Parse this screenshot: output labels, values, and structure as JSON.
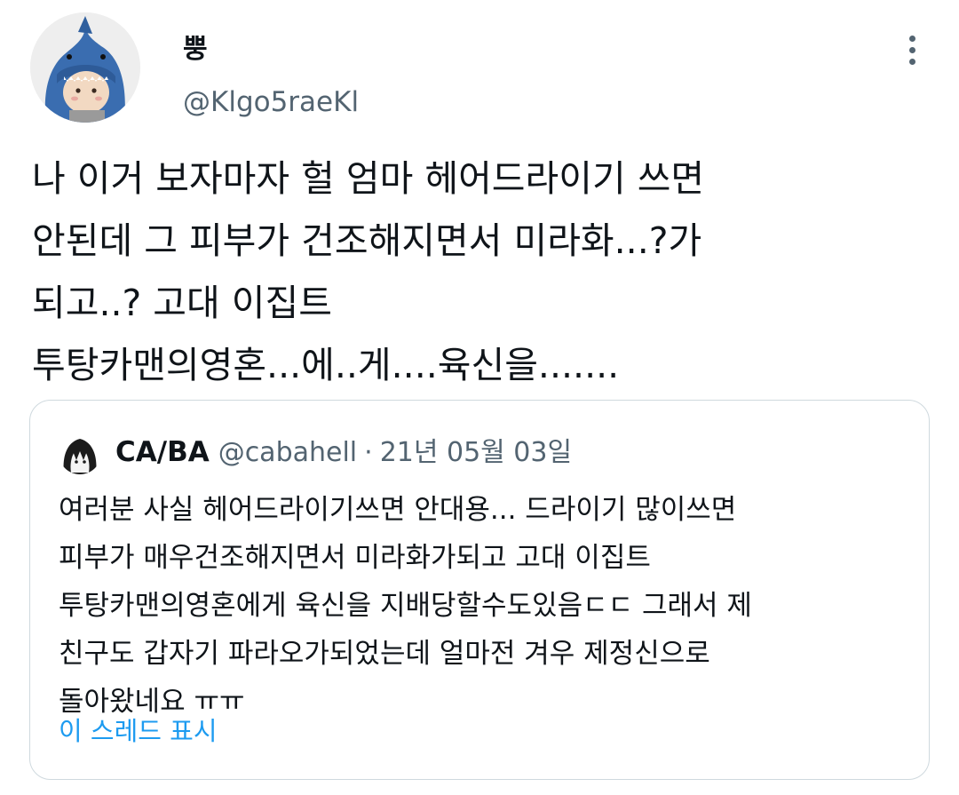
{
  "author": {
    "display_name": "뿡",
    "handle": "@Klgo5raeKl",
    "avatar_icon": "shark-costume-plush-avatar"
  },
  "more_icon": "more-horizontal-icon",
  "body_lines": [
    "나 이거 보자마자 헐 엄마 헤어드라이기 쓰면",
    "안된데 그 피부가 건조해지면서 미라화...?가",
    "되고..? 고대 이집트",
    "투탕카맨의영혼...에..게....육신을......."
  ],
  "quoted_tweet": {
    "display_name": "CA/BA",
    "handle": "@cabahell",
    "separator": "·",
    "date": "21년 05월 03일",
    "avatar_icon": "anime-character-avatar",
    "text_lines": [
      "여러분 사실 헤어드라이기쓰면 안대용... 드라이기 많이쓰면",
      "피부가 매우건조해지면서 미라화가되고 고대 이집트",
      "투탕카맨의영혼에게 육신을 지배당할수도있음ㄷㄷ 그래서 제",
      "친구도 갑자기 파라오가되었는데 얼마전 겨우 제정신으로",
      "돌아왔네요 ㅠㅠ"
    ],
    "show_thread_label": "이 스레드 표시"
  },
  "colors": {
    "text_primary": "#0f1419",
    "text_secondary": "#536471",
    "link": "#1d9bf0",
    "border": "#cfd9de"
  }
}
